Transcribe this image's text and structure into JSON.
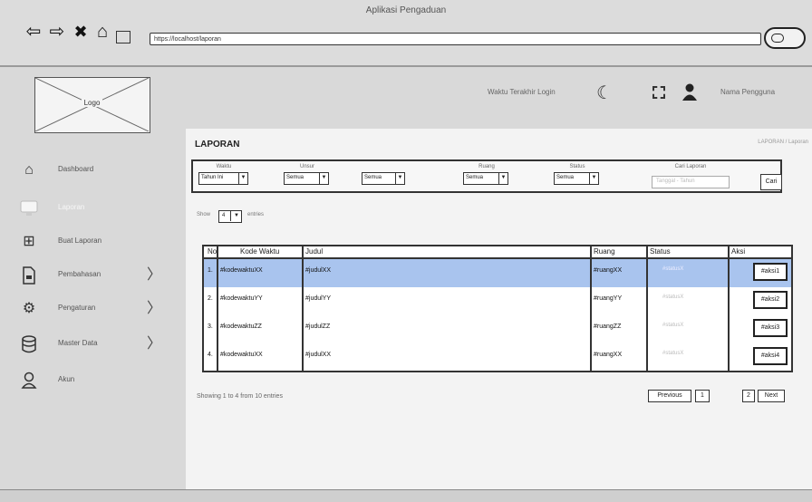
{
  "window": {
    "title": "Aplikasi Pengaduan"
  },
  "browser": {
    "back_icon": "arrow-left-icon",
    "forward_icon": "arrow-right-icon",
    "close_icon": "x-icon",
    "home_icon": "home-icon",
    "url": "https://localhost/laporan"
  },
  "header": {
    "logo_label": "Logo",
    "last_login": "Waktu Terakhir Login",
    "user_name": "Nama Pengguna"
  },
  "sidebar": {
    "items": [
      {
        "label": "Dashboard",
        "icon": "home-icon",
        "has_submenu": false
      },
      {
        "label": "Laporan",
        "icon": "monitor-icon",
        "has_submenu": false,
        "active": true
      },
      {
        "label": "Buat Laporan",
        "icon": "plus-square-icon",
        "has_submenu": false
      },
      {
        "label": "Pembahasan",
        "icon": "document-icon",
        "has_submenu": true
      },
      {
        "label": "Pengaturan",
        "icon": "gear-icon",
        "has_submenu": true
      },
      {
        "label": "Master Data",
        "icon": "database-icon",
        "has_submenu": true
      },
      {
        "label": "Akun",
        "icon": "user-icon",
        "has_submenu": false
      }
    ]
  },
  "main": {
    "title": "LAPORAN",
    "breadcrumb": "LAPORAN / Laporan",
    "filters": [
      {
        "label": "Waktu",
        "value": "Tahun Ini"
      },
      {
        "label": "Unsur",
        "value": "Semua"
      },
      {
        "label": "",
        "value": "Semua"
      },
      {
        "label": "Ruang",
        "value": "Semua"
      },
      {
        "label": "Status",
        "value": "Semua"
      }
    ],
    "date_filter": {
      "label": "Cari Laporan",
      "placeholder": "Tanggal - Tahun"
    },
    "search_button": "Cari",
    "show": {
      "before": "Show",
      "value": "4",
      "after": "entries"
    },
    "table": {
      "columns": [
        "No",
        "Kode Waktu",
        "Judul",
        "Ruang",
        "Status",
        "Aksi"
      ],
      "rows": [
        {
          "no": "1.",
          "kode": "#kodewaktuXX",
          "judul": "#judulXX",
          "ruang": "#ruangXX",
          "status": "#statusX",
          "aksi": "#aksi1"
        },
        {
          "no": "2.",
          "kode": "#kodewaktuYY",
          "judul": "#judulYY",
          "ruang": "#ruangYY",
          "status": "#statusX",
          "aksi": "#aksi2"
        },
        {
          "no": "3.",
          "kode": "#kodewaktuZZ",
          "judul": "#judulZZ",
          "ruang": "#ruangZZ",
          "status": "#statusX",
          "aksi": "#aksi3"
        },
        {
          "no": "4.",
          "kode": "#kodewaktuXX",
          "judul": "#judulXX",
          "ruang": "#ruangXX",
          "status": "#statusX",
          "aksi": "#aksi4"
        }
      ]
    },
    "footer_info": "Showing 1 to 4 from 10 entries",
    "pagination": {
      "previous": "Previous",
      "pages": [
        "1",
        "2"
      ],
      "next": "Next"
    }
  },
  "colors": {
    "selected_row": "#a9c4ee",
    "chrome": "#dcdcdc"
  }
}
